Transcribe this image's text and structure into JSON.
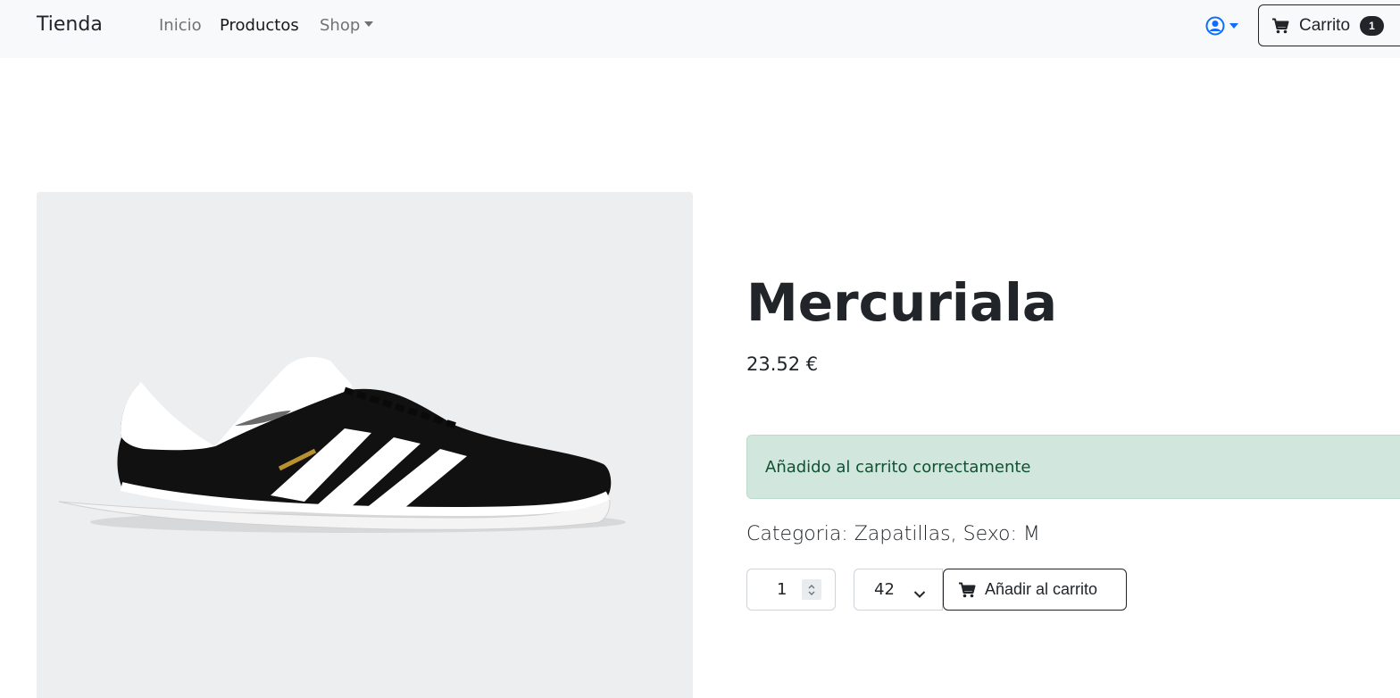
{
  "navbar": {
    "brand": "Tienda",
    "links": [
      {
        "label": "Inicio",
        "active": false
      },
      {
        "label": "Productos",
        "active": true
      },
      {
        "label": "Shop",
        "active": false,
        "dropdown": true
      }
    ],
    "user_icon": "user-circle-icon",
    "cart": {
      "label": "Carrito",
      "count": "1",
      "icon": "cart-icon"
    }
  },
  "product": {
    "name": "Mercuriala",
    "price": "23.52 €",
    "image_icon": "sneaker-image",
    "category_text": "Categoria: Zapatillas, Sexo: M"
  },
  "alert": {
    "message": "Añadido al carrito correctamente",
    "color": "#d1e7dd",
    "text_color": "#0f5132"
  },
  "form": {
    "quantity": "1",
    "size": "42",
    "add_button_label": "Añadir al carrito"
  },
  "colors": {
    "accent": "#0d6efd",
    "navbar_bg": "#f8f9fa",
    "dark": "#212529"
  }
}
